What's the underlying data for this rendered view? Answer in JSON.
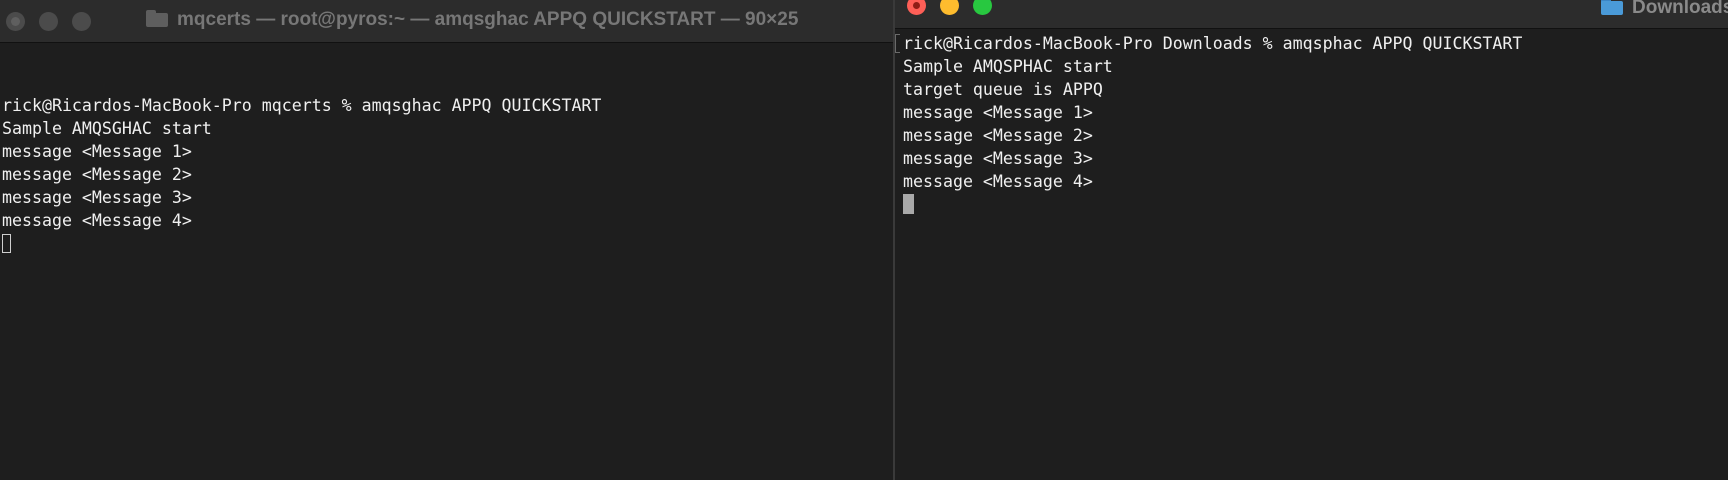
{
  "left_window": {
    "title": "mqcerts — root@pyros:~ — amqsghac APPQ QUICKSTART — 90×25",
    "lines": [
      "",
      "rick@Ricardos-MacBook-Pro mqcerts % amqsghac APPQ QUICKSTART",
      "Sample AMQSGHAC start",
      "message <Message 1>",
      "message <Message 2>",
      "message <Message 3>",
      "message <Message 4>"
    ]
  },
  "right_window": {
    "title": "Downloads",
    "lines": [
      "rick@Ricardos-MacBook-Pro Downloads % amqsphac APPQ QUICKSTART",
      "Sample AMQSPHAC start",
      "target queue is APPQ",
      "message <Message 1>",
      "message <Message 2>",
      "message <Message 3>",
      "message <Message 4>"
    ]
  },
  "icons": {
    "left_title_icon": "folder-icon",
    "right_title_icon": "folder-icon",
    "left_cursor": "cursor-hollow-block",
    "right_cursor": "cursor-solid-block"
  },
  "colors": {
    "terminal_background": "#1e1e1e",
    "terminal_text": "#f0f0f0",
    "close_button": "#fe5f57",
    "minimize_button": "#febc2e",
    "zoom_button": "#28c840",
    "inactive_button": "#4b4b4b"
  }
}
